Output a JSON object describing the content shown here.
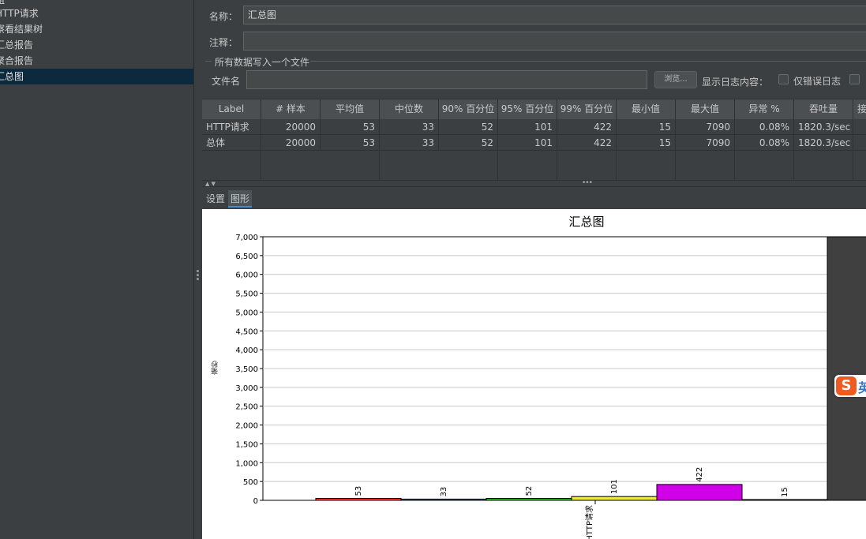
{
  "tree": {
    "items": [
      {
        "label": "组"
      },
      {
        "label": "HTTP请求"
      },
      {
        "label": "察看结果树"
      },
      {
        "label": "汇总报告"
      },
      {
        "label": "聚合报告"
      },
      {
        "label": "汇总图",
        "selected": true
      }
    ]
  },
  "form": {
    "name_label": "名称：",
    "name_value": "汇总图",
    "comment_label": "注释：",
    "comment_value": "",
    "fieldset_title": "所有数据写入一个文件",
    "filename_label": "文件名",
    "filename_value": "",
    "browse_label": "浏览...",
    "log_label": "显示日志内容：",
    "errors_only_label": "仅错误日志"
  },
  "table": {
    "headers": [
      "Label",
      "# 样本",
      "平均值",
      "中位数",
      "90% 百分位",
      "95% 百分位",
      "99% 百分位",
      "最小值",
      "最大值",
      "异常 %",
      "吞吐量",
      "接"
    ],
    "rows": [
      [
        "HTTP请求",
        "20000",
        "53",
        "33",
        "52",
        "101",
        "422",
        "15",
        "7090",
        "0.08%",
        "1820.3/sec",
        ""
      ],
      [
        "总体",
        "20000",
        "53",
        "33",
        "52",
        "101",
        "422",
        "15",
        "7090",
        "0.08%",
        "1820.3/sec",
        ""
      ]
    ]
  },
  "tabs": [
    {
      "label": "设置"
    },
    {
      "label": "图形",
      "active": true
    }
  ],
  "chart_data": {
    "type": "bar",
    "title": "汇总图",
    "ylabel": "毫秒",
    "category": "HTTP请求",
    "ylim": [
      0,
      7000
    ],
    "yticks": [
      "0",
      "500",
      "1,000",
      "1,500",
      "2,000",
      "2,500",
      "3,000",
      "3,500",
      "4,000",
      "4,500",
      "5,000",
      "5,500",
      "6,000",
      "6,500",
      "7,000"
    ],
    "series": [
      {
        "value": 53,
        "color": "#ff4040"
      },
      {
        "value": 33,
        "color": "#4080ff"
      },
      {
        "value": 52,
        "color": "#40c040"
      },
      {
        "value": 101,
        "color": "#e8e840"
      },
      {
        "value": 422,
        "color": "#d000e8"
      },
      {
        "value": 15,
        "color": "#30d0d0"
      },
      {
        "value": 7090,
        "color": "#404040"
      }
    ]
  },
  "colors": {
    "bg": "#3c3f41",
    "selected": "#0d293e"
  }
}
